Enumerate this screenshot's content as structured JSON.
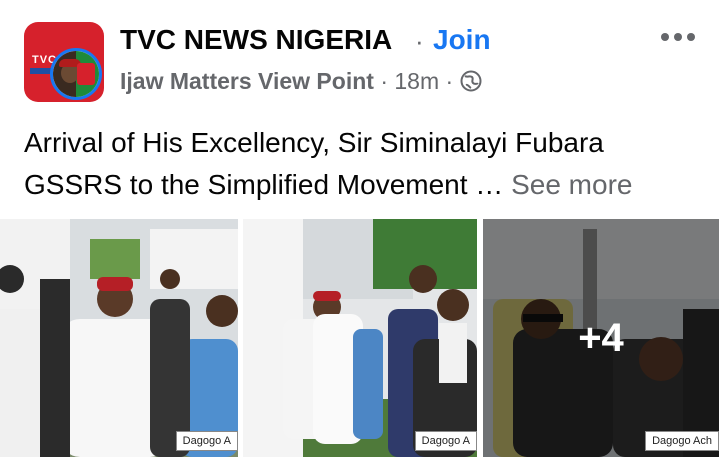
{
  "header": {
    "page_name": "TVC NEWS NIGERIA",
    "separator": "·",
    "join_label": "Join",
    "author": "Ijaw Matters View Point",
    "time": "18m",
    "sub_separator": "·",
    "logo_text": "TVC",
    "more_icon": "more-horizontal-icon",
    "globe_icon": "globe-icon"
  },
  "post": {
    "text": "Arrival of His Excellency, Sir Siminalayi Fubara GSSRS to the Simplified Movement …",
    "see_more": "See more"
  },
  "photos": [
    {
      "watermark": "Dagogo A"
    },
    {
      "watermark": "Dagogo A"
    },
    {
      "watermark": "Dagogo Ach",
      "overlay_count": "+4"
    }
  ],
  "colors": {
    "accent": "#1877f2",
    "secondary_text": "#65676b",
    "primary_text": "#050505",
    "logo_red": "#d6212c"
  }
}
